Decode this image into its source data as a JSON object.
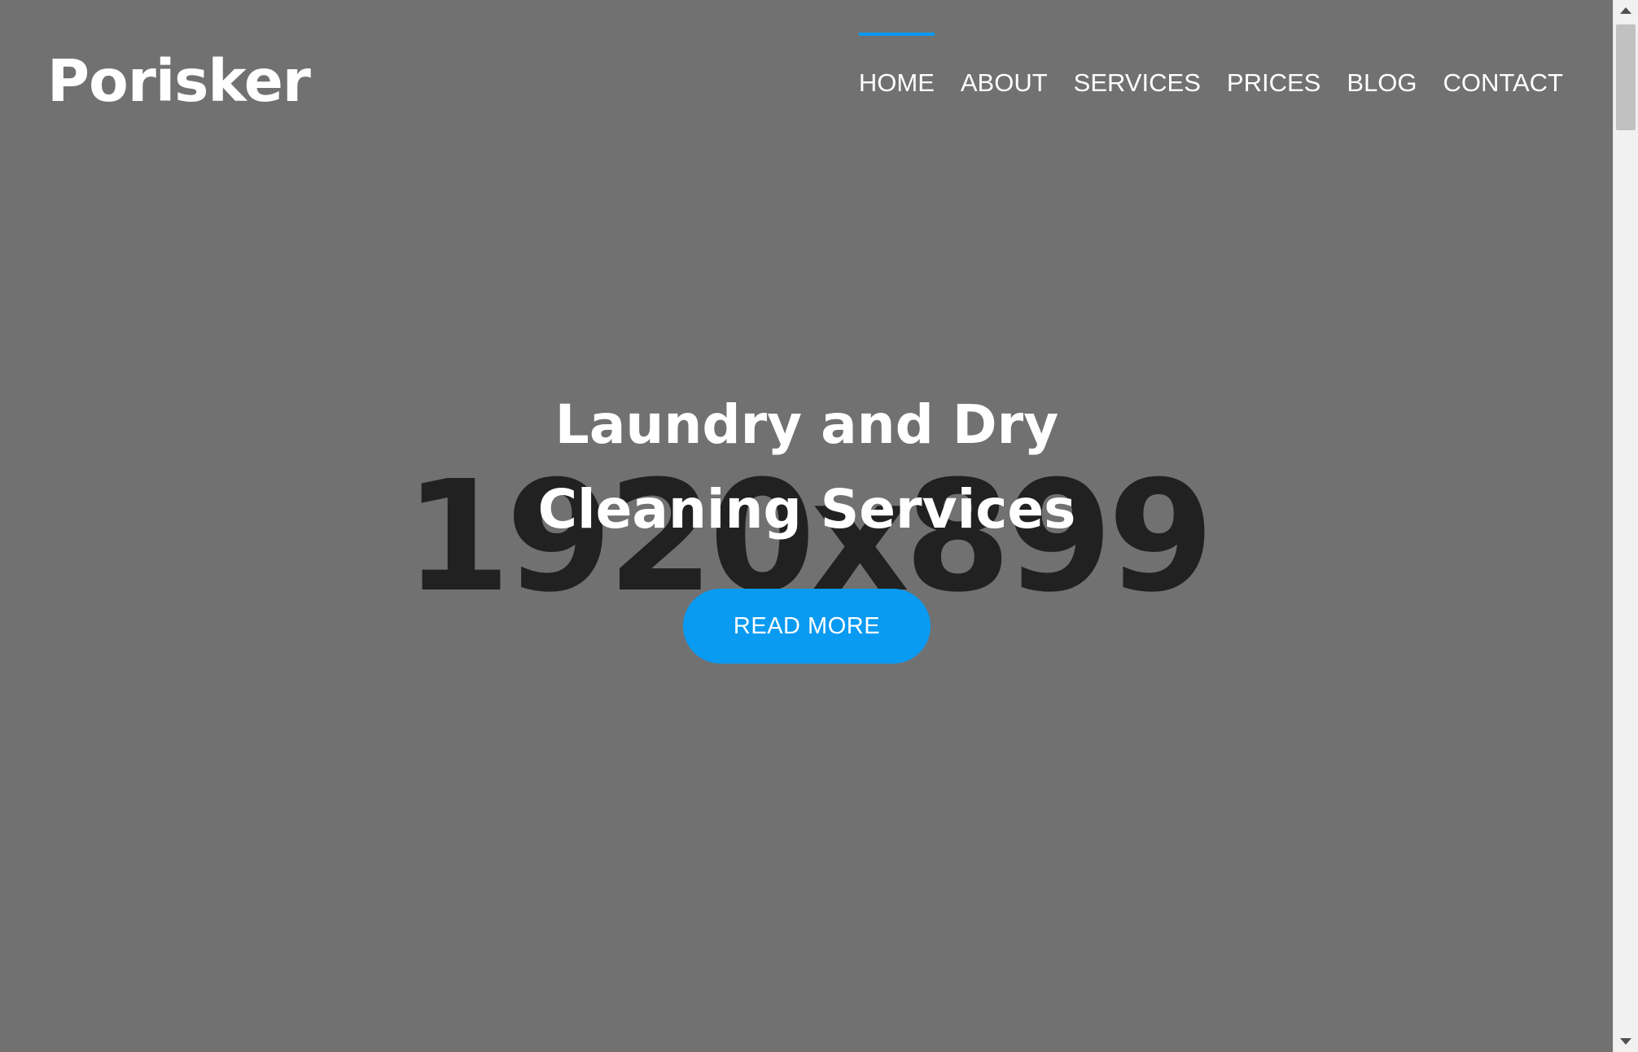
{
  "brand": {
    "logo_text": "Porisker"
  },
  "nav": {
    "items": [
      {
        "label": "HOME",
        "active": true
      },
      {
        "label": "ABOUT",
        "active": false
      },
      {
        "label": "SERVICES",
        "active": false
      },
      {
        "label": "PRICES",
        "active": false
      },
      {
        "label": "BLOG",
        "active": false
      },
      {
        "label": "CONTACT",
        "active": false
      }
    ]
  },
  "hero": {
    "placeholder_text": "1920x899",
    "headline_line1": "Laundry and Dry",
    "headline_line2": "Cleaning Services",
    "cta_label": "READ MORE"
  },
  "icons": {
    "scroll_up": "arrow-up-icon",
    "scroll_down": "arrow-down-icon"
  },
  "colors": {
    "accent": "#099af2",
    "background": "#717171",
    "placeholder_text": "#212121",
    "text": "#ffffff"
  }
}
